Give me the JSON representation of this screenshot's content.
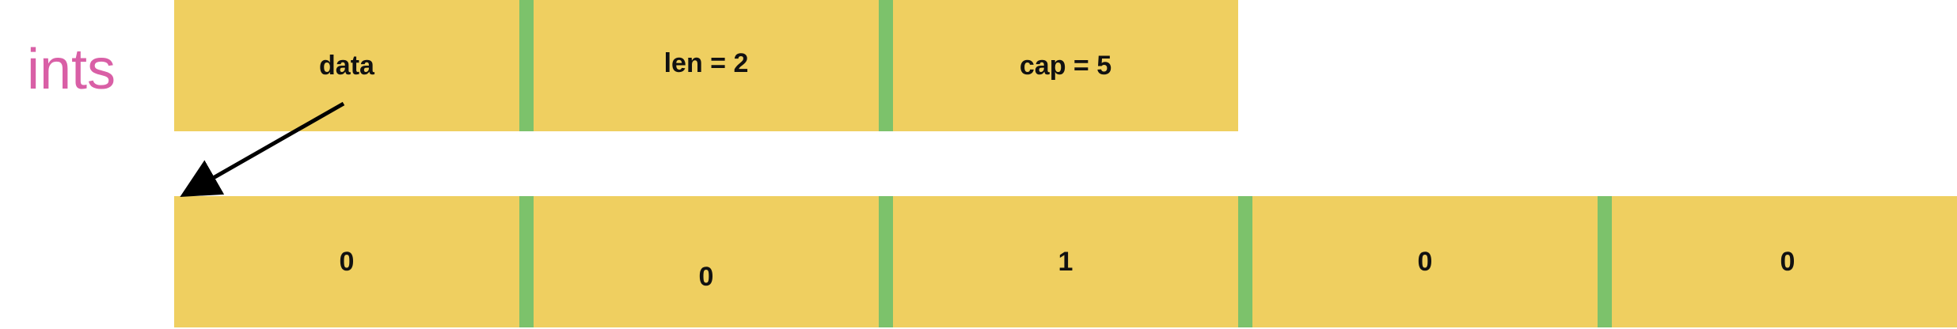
{
  "variable_name": "ints",
  "slice_header": {
    "fields": [
      "data",
      "len = 2",
      "cap = 5"
    ]
  },
  "backing_array": {
    "values": [
      "0",
      "0",
      "1",
      "0",
      "0"
    ]
  },
  "colors": {
    "cell_fill": "#efcf60",
    "separator": "#7cc26b",
    "label": "#d95fa6",
    "arrow": "#000000"
  }
}
